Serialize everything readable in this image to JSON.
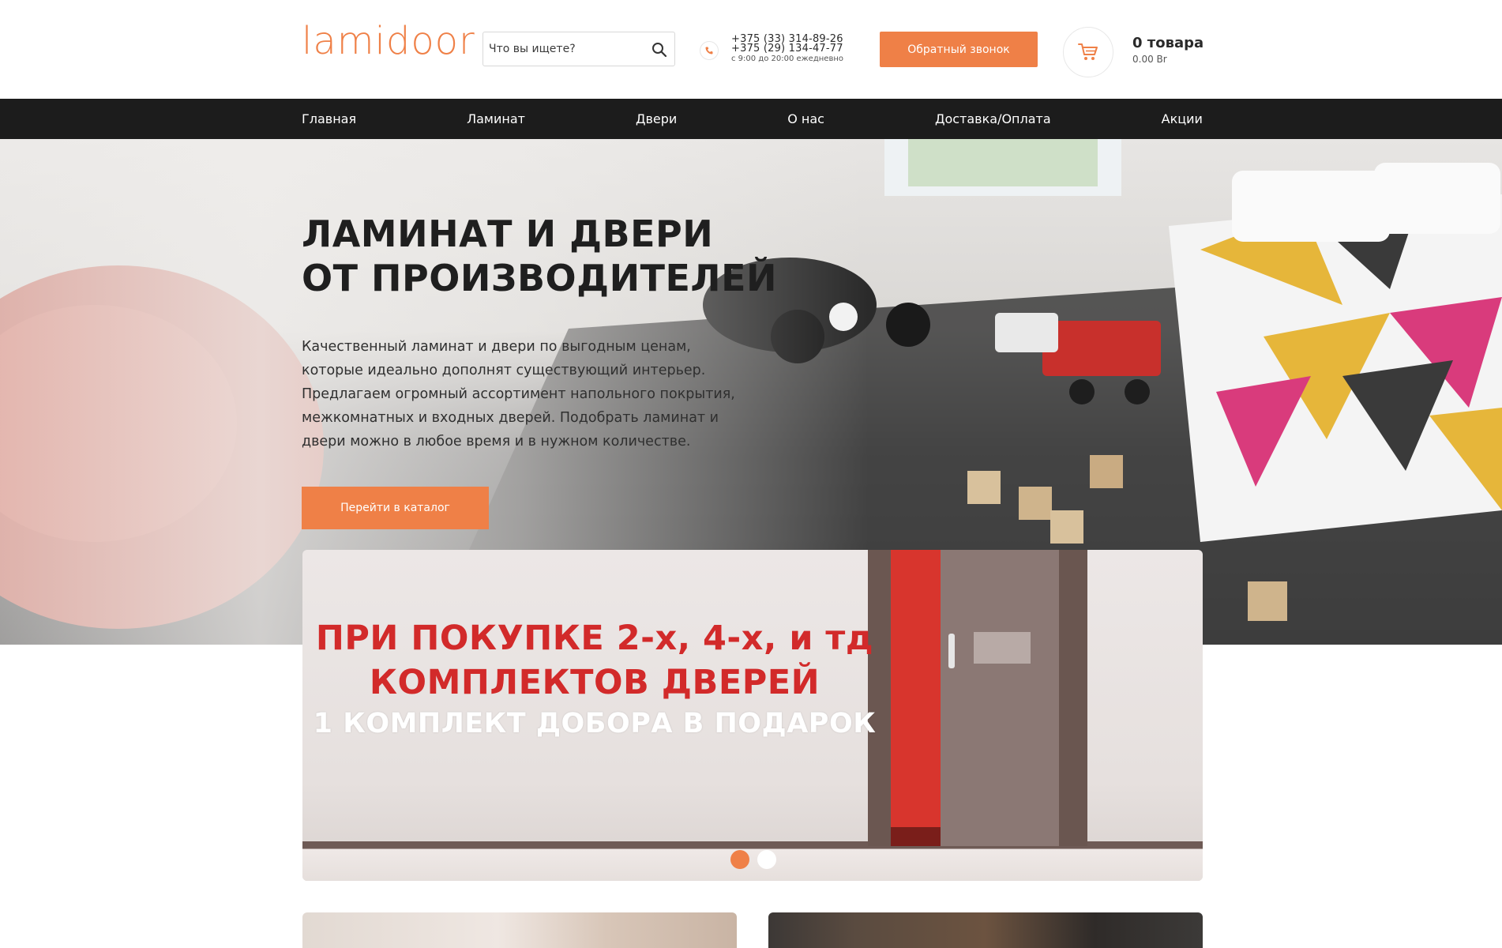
{
  "header": {
    "logo": "lamidoor",
    "search_placeholder": "Что вы ищете?",
    "phone1": "+375 (33) 314-89-26",
    "phone2": "+375 (29) 134-47-77",
    "hours": "с 9:00 до 20:00 ежедневно",
    "callback_label": "Обратный звонок",
    "cart_count": "0 товара",
    "cart_sum": "0.00 Br"
  },
  "nav": {
    "items": [
      {
        "label": "Главная"
      },
      {
        "label": "Ламинат"
      },
      {
        "label": "Двери"
      },
      {
        "label": "О нас"
      },
      {
        "label": "Доставка/Оплата"
      },
      {
        "label": "Акции"
      }
    ]
  },
  "hero": {
    "title_line1": "ЛАМИНАТ И ДВЕРИ",
    "title_line2": "ОТ ПРОИЗВОДИТЕЛЕЙ",
    "text": "Качественный ламинат и двери по выгодным ценам, которые идеально дополнят существующий интерьер. Предлагаем огромный ассортимент напольного покрытия, межкомнатных и входных дверей. Подобрать ламинат и двери можно в любое время и в нужном количестве.",
    "cta_label": "Перейти в каталог"
  },
  "banner": {
    "line1": "ПРИ ПОКУПКЕ 2-х, 4-х, и тд",
    "line2": "КОМПЛЕКТОВ ДВЕРЕЙ",
    "line3": "1 КОМПЛЕКТ ДОБОРА В ПОДАРОК",
    "slides_total": 2,
    "active_slide": 1
  },
  "colors": {
    "accent": "#ef8047",
    "nav_bg": "#1c1c1c",
    "banner_red": "#d22a2a"
  },
  "icons": [
    "search-icon",
    "phone-icon",
    "cart-icon"
  ]
}
